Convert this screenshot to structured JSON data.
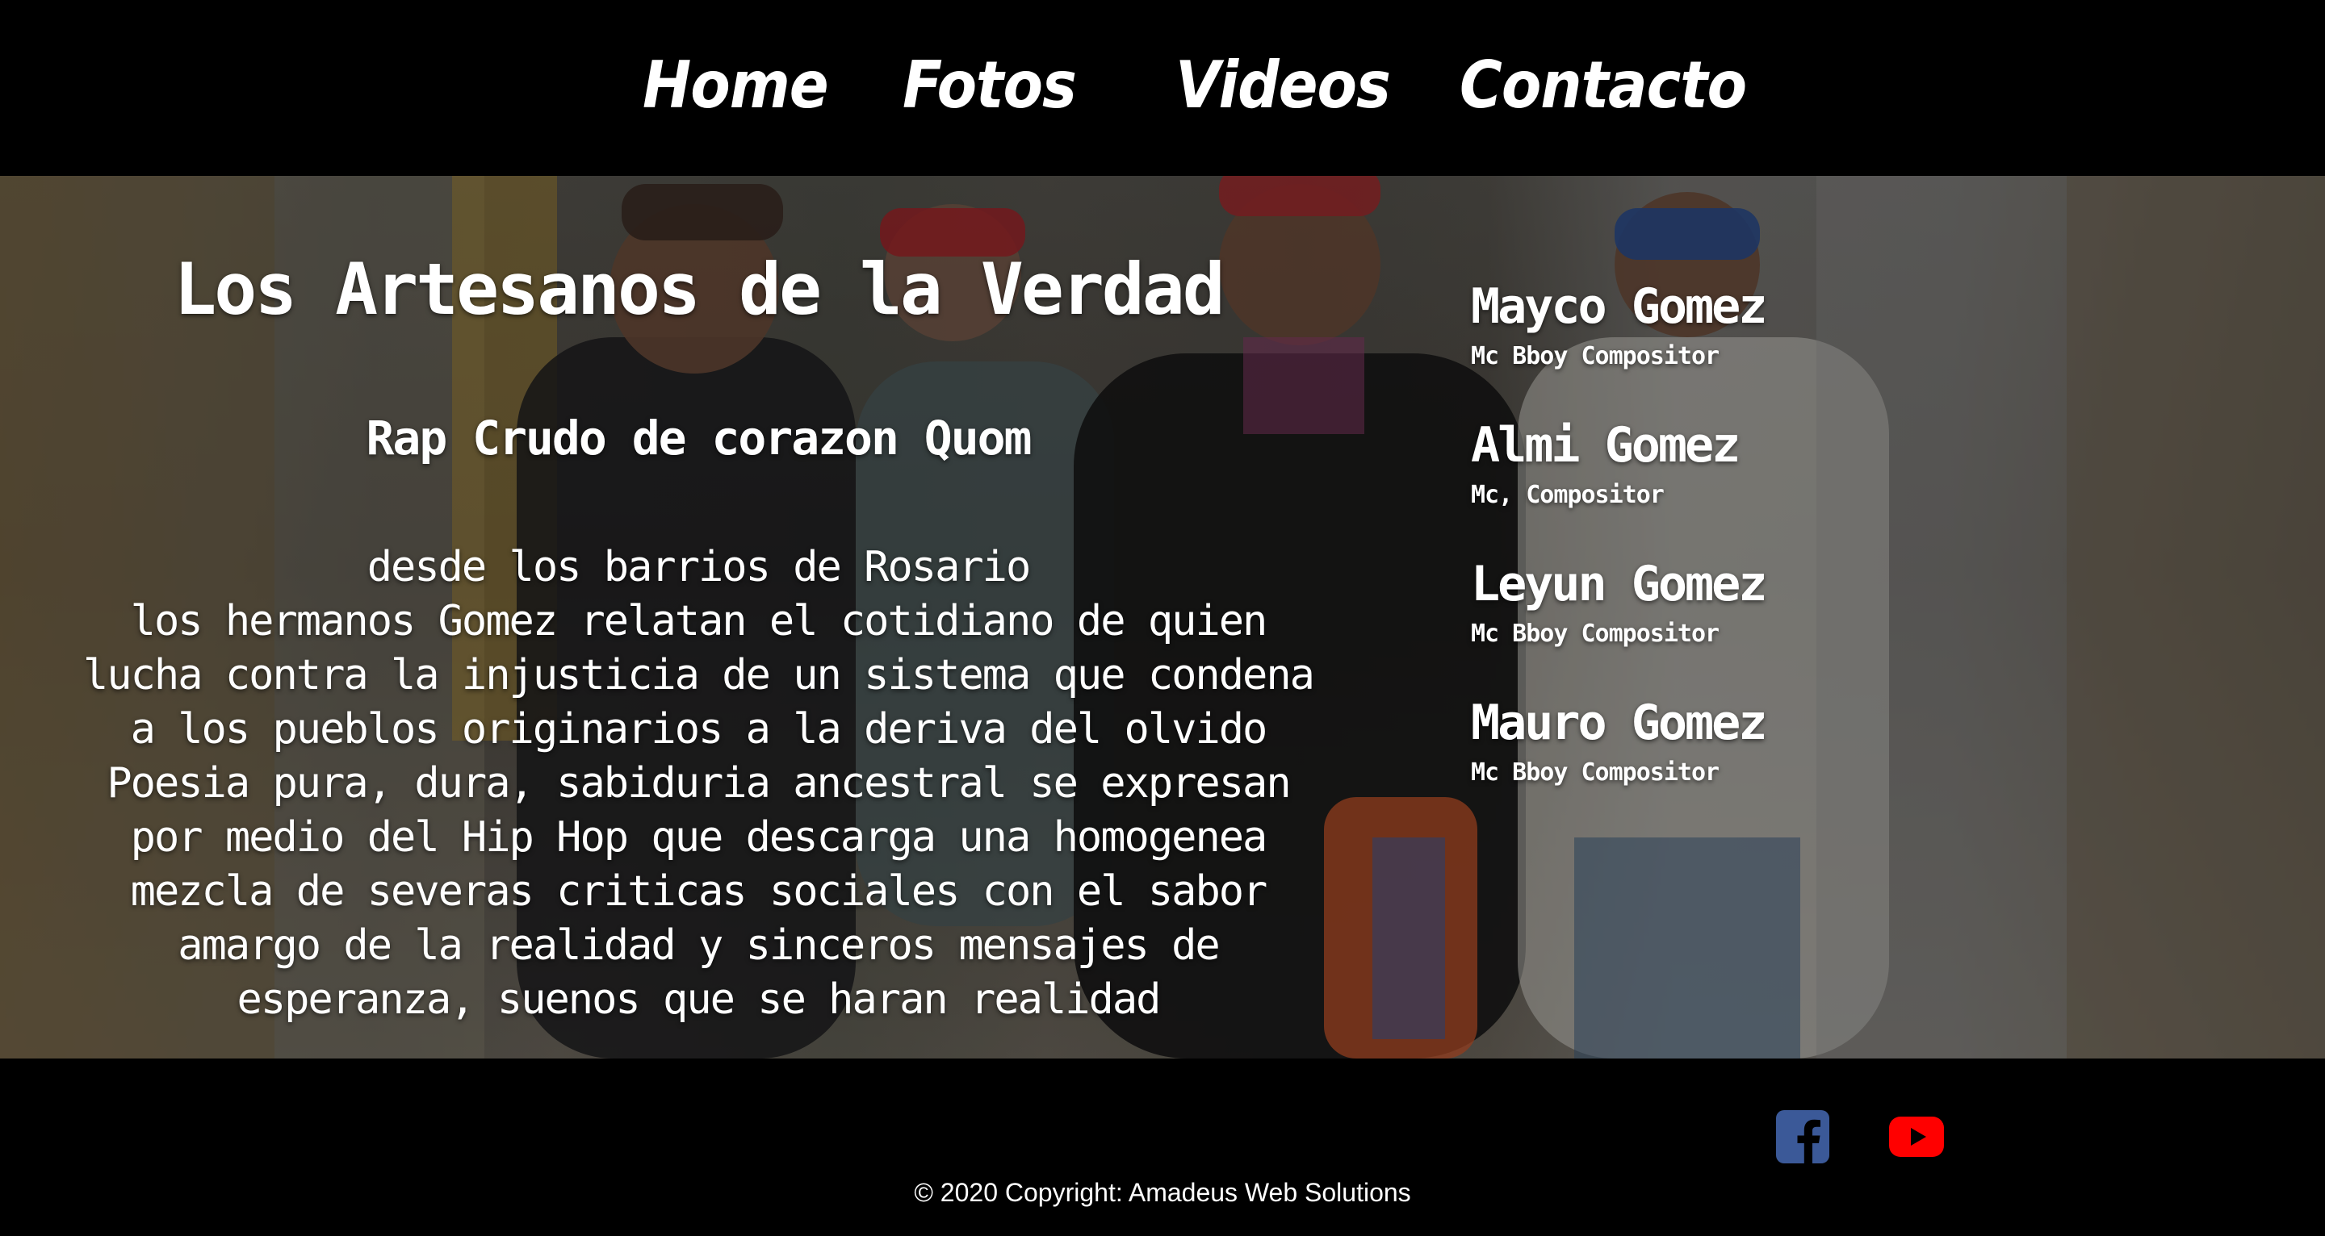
{
  "nav": {
    "items": [
      {
        "label": "Home"
      },
      {
        "label": "Fotos"
      },
      {
        "label": "Videos"
      },
      {
        "label": "Contacto"
      }
    ]
  },
  "hero": {
    "title": "Los Artesanos de la Verdad",
    "subtitle": "Rap Crudo de corazon Quom",
    "paragraphs": [
      "desde los barrios de Rosario",
      "los hermanos Gomez relatan el cotidiano de quien lucha contra la injusticia de un sistema que condena a los pueblos originarios a la deriva del olvido",
      "Poesia pura, dura, sabiduria ancestral se expresan por medio del Hip Hop que descarga una homogenea mezcla de severas criticas sociales con el sabor amargo de la realidad y sinceros mensajes de esperanza, suenos que se haran realidad"
    ]
  },
  "members": [
    {
      "name": "Mayco Gomez",
      "role": "Mc Bboy Compositor"
    },
    {
      "name": "Almi Gomez",
      "role": "Mc, Compositor"
    },
    {
      "name": "Leyun Gomez",
      "role": "Mc Bboy Compositor"
    },
    {
      "name": "Mauro Gomez",
      "role": "Mc Bboy Compositor"
    }
  ],
  "footer": {
    "social": [
      {
        "icon": "facebook-icon",
        "color": "#3b5998"
      },
      {
        "icon": "youtube-icon",
        "color": "#ff0000"
      }
    ],
    "copyright": "© 2020 Copyright: Amadeus Web Solutions"
  }
}
